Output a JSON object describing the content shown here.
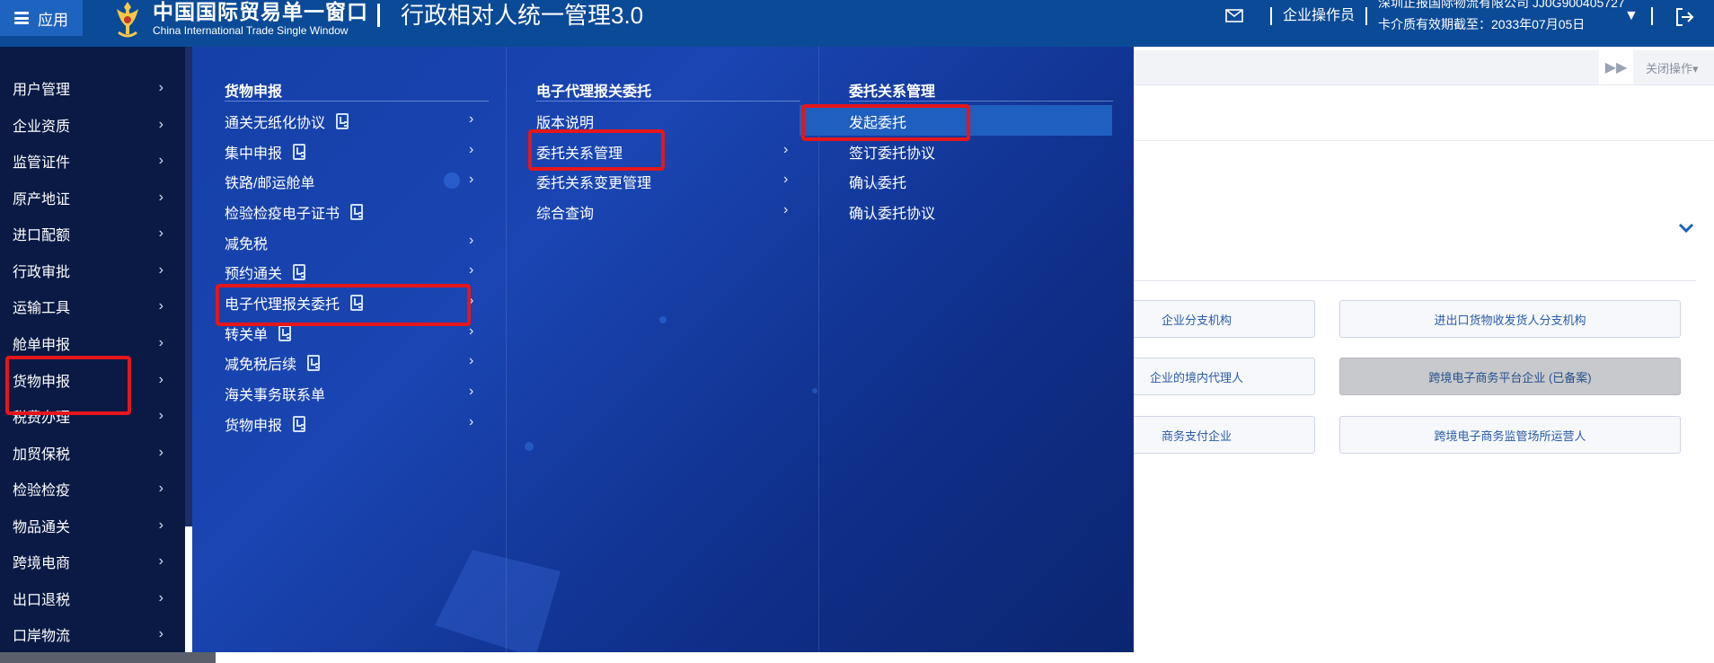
{
  "header": {
    "app_label": "应用",
    "brand_cn": "中国国际贸易单一窗口",
    "brand_en": "China International Trade Single Window",
    "system_title": "行政相对人统一管理3.0",
    "role": "企业操作员",
    "company": "深圳正报国际物流有限公司 JJ0G900405727",
    "validity": "卡介质有效期截至：2033年07月05日",
    "caret": "▼"
  },
  "tabs": {
    "forward": "▶▶",
    "close_ops": "关闭操作▾"
  },
  "cards": [
    "企业分支机构",
    "进出口货物收发货人分支机构",
    "企业的境内代理人",
    "跨境电子商务平台企业 (已备案)",
    "商务支付企业",
    "跨境电子商务监管场所运营人"
  ],
  "sidebar": {
    "items": [
      "用户管理",
      "企业资质",
      "监管证件",
      "原产地证",
      "进口配额",
      "行政审批",
      "运输工具",
      "舱单申报",
      "货物申报",
      "税费办理",
      "加贸保税",
      "检验检疫",
      "物品通关",
      "跨境电商",
      "出口退税",
      "口岸物流"
    ]
  },
  "menu": {
    "col1": {
      "title": "货物申报",
      "items": [
        "通关无纸化协议",
        "集中申报",
        "铁路/邮运舱单",
        "检验检疫电子证书",
        "减免税",
        "预约通关",
        "电子代理报关委托",
        "转关单",
        "减免税后续",
        "海关事务联系单",
        "货物申报"
      ]
    },
    "col2": {
      "title": "电子代理报关委托",
      "items": [
        "版本说明",
        "委托关系管理",
        "委托关系变更管理",
        "综合查询"
      ]
    },
    "col3": {
      "title": "委托关系管理",
      "items": [
        "发起委托",
        "签订委托协议",
        "确认委托",
        "确认委托协议"
      ]
    }
  },
  "chevron": "›"
}
